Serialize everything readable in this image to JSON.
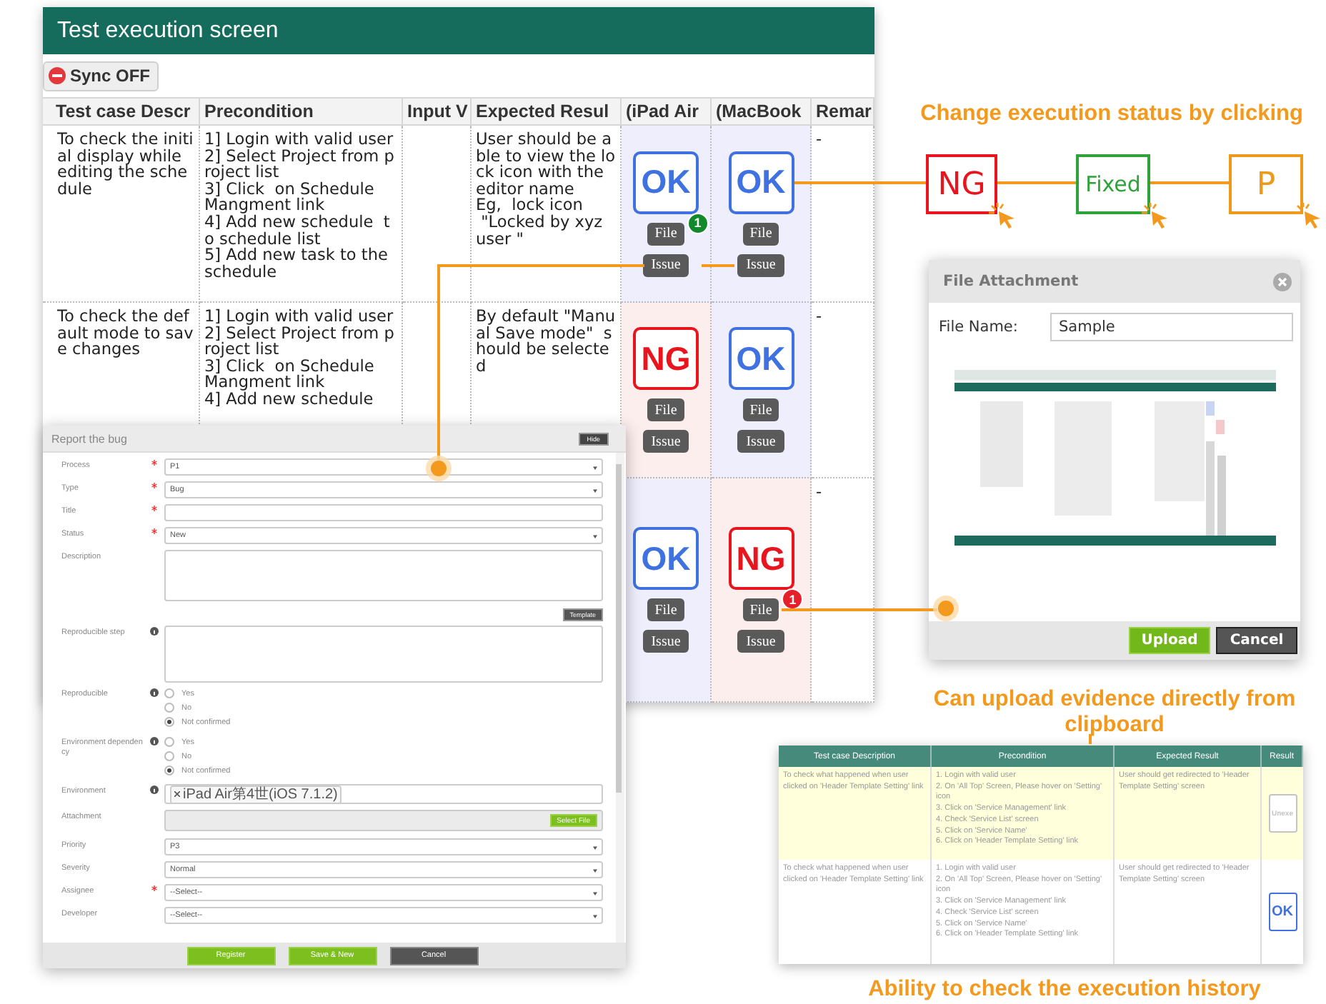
{
  "main_screen": {
    "title": "Test execution screen",
    "sync_button": "Sync OFF",
    "columns": [
      "Test case Descr",
      "Precondition",
      "Input V",
      "Expected Resul",
      "(iPad Air",
      "(MacBook",
      "Remar"
    ],
    "rows": [
      {
        "description": "To check the initial display while editing the schedule",
        "precondition": "1] Login with valid user\n2] Select Project from project list\n3] Click  on Schedule  Mangment link\n4] Add new schedule  to schedule list\n5] Add new task to the schedule",
        "expected": "User should be able to view the lock icon with the editor name\nEg,  lock icon\n \"Locked by xyz user \"",
        "results": [
          {
            "result": "OK",
            "kind": "ok",
            "file": "File",
            "issue": "Issue",
            "badge": {
              "count": "1",
              "color": "#128a2c"
            }
          },
          {
            "result": "OK",
            "kind": "ok",
            "file": "File",
            "issue": "Issue"
          }
        ],
        "remarks": "-"
      },
      {
        "description": "To check the default mode to save changes",
        "precondition": "1] Login with valid user\n2] Select Project from project list\n3] Click  on Schedule  Mangment link\n4] Add new schedule",
        "expected": "By default \"Manual Save mode\"  should be selected",
        "results": [
          {
            "result": "NG",
            "kind": "ng",
            "file": "File",
            "issue": "Issue"
          },
          {
            "result": "OK",
            "kind": "ok",
            "file": "File",
            "issue": "Issue"
          }
        ],
        "remarks": "-"
      },
      {
        "results": [
          {
            "result": "OK",
            "kind": "ok",
            "file": "File",
            "issue": "Issue"
          },
          {
            "result": "NG",
            "kind": "ng",
            "file": "File",
            "issue": "Issue",
            "badge": {
              "count": "1",
              "color": "#e5202a"
            }
          }
        ],
        "remarks": "-"
      }
    ]
  },
  "status_annotation": {
    "caption": "Change execution status by clicking",
    "options": [
      {
        "label": "NG",
        "color": "#e8141e"
      },
      {
        "label": "Fixed",
        "color": "#2ea33a"
      },
      {
        "label": "P",
        "color": "#eb9a1a"
      }
    ]
  },
  "file_dialog": {
    "title": "File Attachment",
    "file_name_label": "File Name:",
    "file_name": "Sample",
    "buttons": [
      {
        "label": "Upload",
        "kind": "primary"
      },
      {
        "label": "Cancel",
        "kind": "secondary"
      }
    ]
  },
  "clipboard_caption": "Can upload evidence directly from clipboard",
  "bug_form": {
    "title": "Report the bug",
    "hide_button": "Hide",
    "fields": [
      {
        "label": "Process",
        "required": true,
        "info": false,
        "kind": "select",
        "value": "P1"
      },
      {
        "label": "Type",
        "required": true,
        "info": false,
        "kind": "select",
        "value": "Bug"
      },
      {
        "label": "Title",
        "required": true,
        "info": false,
        "kind": "text"
      },
      {
        "label": "Status",
        "required": true,
        "info": false,
        "kind": "select",
        "value": "New"
      },
      {
        "label": "Description",
        "required": false,
        "info": false,
        "kind": "textarea",
        "button": "Template"
      },
      {
        "label": "Reproducible step",
        "required": false,
        "info": true,
        "kind": "textarea"
      },
      {
        "label": "Reproducible",
        "required": false,
        "info": true,
        "kind": "radio",
        "options": [
          {
            "label": "Yes",
            "selected": false
          },
          {
            "label": "No",
            "selected": false
          },
          {
            "label": "Not confirmed",
            "selected": true
          }
        ]
      },
      {
        "label": "Environment dependency",
        "required": false,
        "info": true,
        "kind": "radio",
        "options": [
          {
            "label": "Yes",
            "selected": false
          },
          {
            "label": "No",
            "selected": false
          },
          {
            "label": "Not confirmed",
            "selected": true
          }
        ]
      },
      {
        "label": "Environment",
        "required": false,
        "info": true,
        "kind": "tags",
        "tags": [
          "iPad Air第4世(iOS 7.1.2)"
        ]
      },
      {
        "label": "Attachment",
        "required": false,
        "info": false,
        "kind": "file",
        "button": "Select File"
      },
      {
        "label": "Priority",
        "required": false,
        "info": false,
        "kind": "select",
        "value": "P3"
      },
      {
        "label": "Severity",
        "required": false,
        "info": false,
        "kind": "select",
        "value": "Normal"
      },
      {
        "label": "Assignee",
        "required": true,
        "info": false,
        "kind": "select",
        "value": "--Select--"
      },
      {
        "label": "Developer",
        "required": false,
        "info": false,
        "kind": "select",
        "value": "--Select--"
      }
    ],
    "buttons": [
      {
        "label": "Register",
        "kind": "primary"
      },
      {
        "label": "Save & New",
        "kind": "primary"
      },
      {
        "label": "Cancel",
        "kind": "secondary"
      }
    ]
  },
  "history": {
    "columns": [
      "Test case Description",
      "Precondition",
      "Expected Result",
      "Result"
    ],
    "rows": [
      {
        "selected": true,
        "description": "To check what happened when user clicked on 'Header Template Setting' link",
        "precondition": "1. Login with valid user\n2. On 'All Top' Screen, Please hover on 'Setting' icon\n3. Click on 'Service Management' link\n4. Check 'Service List' screen\n5. Click on 'Service Name'\n6. Click on 'Header Template Setting' link",
        "expected": "User should get redirected to 'Header Template Setting' screen",
        "result": "Unexe",
        "kind": "unexecuted"
      },
      {
        "selected": false,
        "description": "To check what happened when user clicked on 'Header Template Setting' link",
        "precondition": "1. Login with valid user\n2. On 'All Top' Screen, Please hover on 'Setting' icon\n3. Click on 'Service Management' link\n4. Check 'Service List' screen\n5. Click on 'Service Name'\n6. Click on 'Header Template Setting' link",
        "expected": "User should get redirected to 'Header Template Setting' screen",
        "result": "OK",
        "kind": "ok"
      }
    ],
    "caption": "Ability to check the execution history"
  }
}
